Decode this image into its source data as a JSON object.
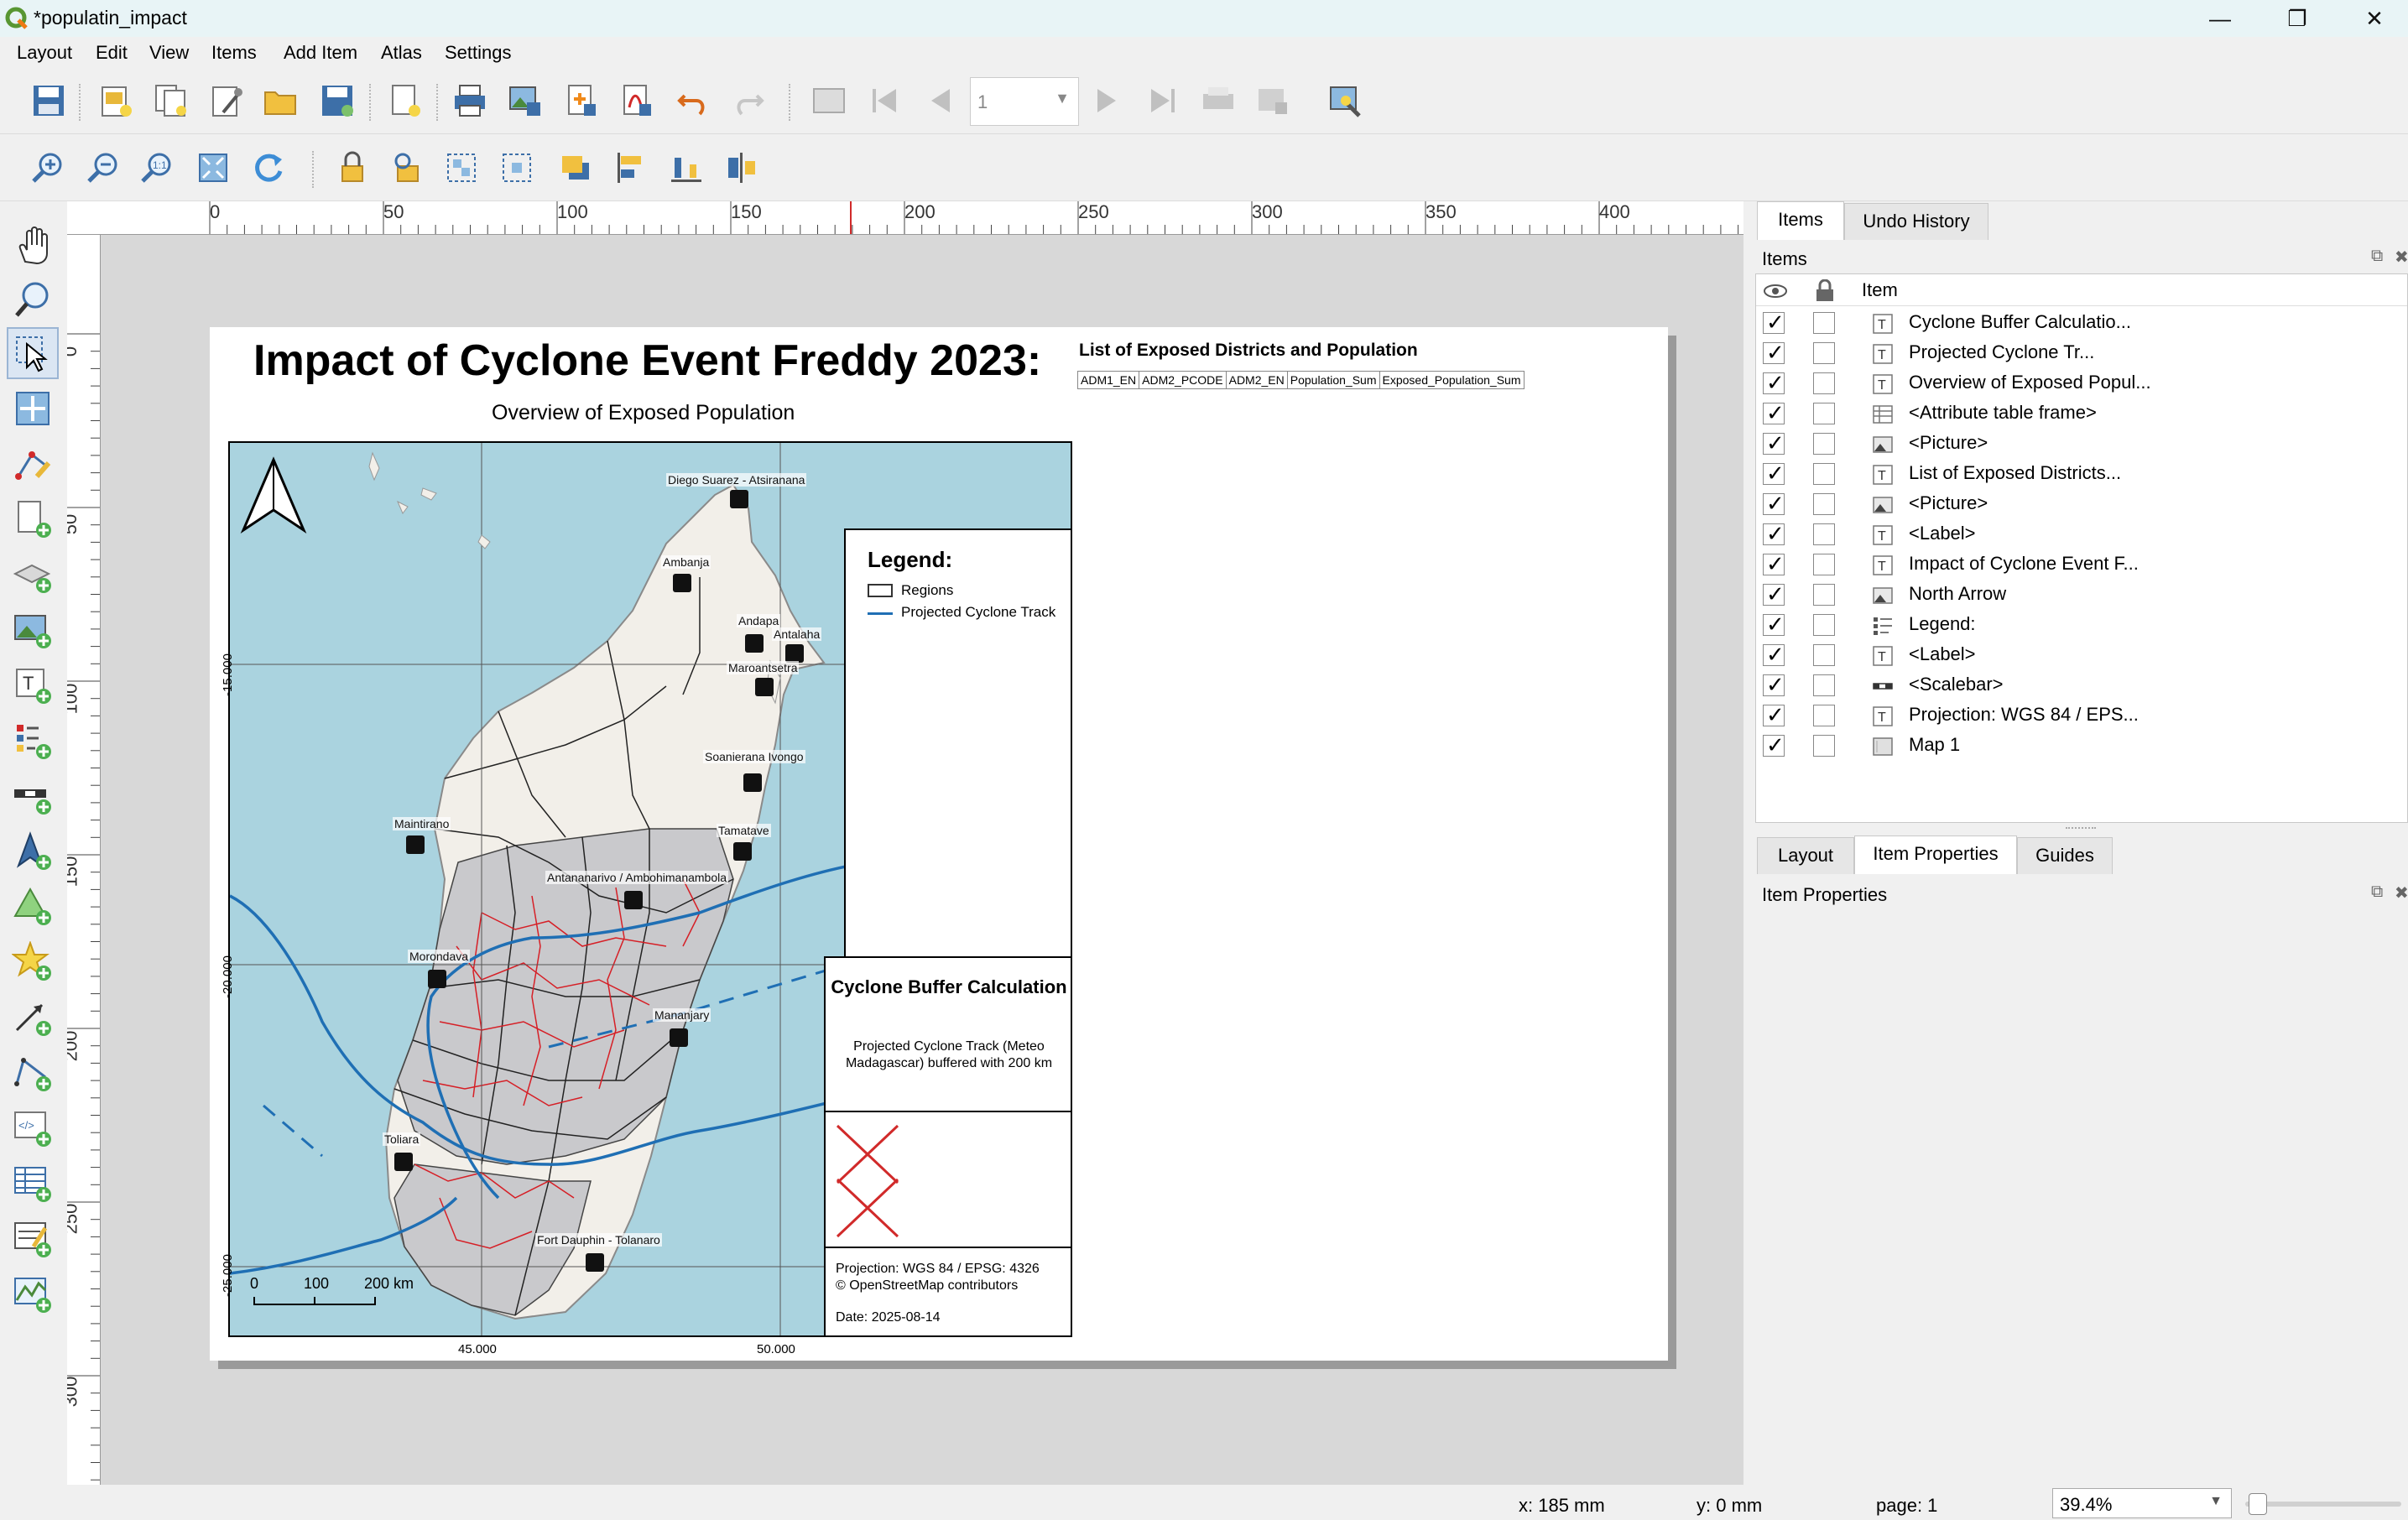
{
  "window": {
    "title": "*populatin_impact",
    "minimize_icon": "minimize-icon",
    "maximize_icon": "restore-icon",
    "close_icon": "close-icon"
  },
  "menubar": {
    "items": [
      "Layout",
      "Edit",
      "View",
      "Items",
      "Add Item",
      "Atlas",
      "Settings"
    ]
  },
  "toolbar": {
    "page_number_value": "1"
  },
  "ruler": {
    "horizontal_labels": [
      "0",
      "50",
      "100",
      "150",
      "200",
      "250",
      "300",
      "350",
      "400"
    ],
    "vertical_labels": [
      "0",
      "50",
      "100",
      "150",
      "200",
      "250",
      "300"
    ]
  },
  "layout": {
    "title": "Impact of Cyclone Event Freddy 2023:",
    "subtitle": "Overview of Exposed Population",
    "table_title": "List of Exposed Districts and Population",
    "table_columns": [
      "ADM1_EN",
      "ADM2_PCODE",
      "ADM2_EN",
      "Population_Sum",
      "Exposed_Population_Sum"
    ],
    "map": {
      "places": [
        "Diego Suarez - Atsiranana",
        "Ambanja",
        "Andapa",
        "Antalaha",
        "Maroantsetra",
        "Soanierana Ivongo",
        "Maintirano",
        "Tamatave",
        "Antananarivo / Ambohimanambola",
        "Morondava",
        "Mananjary",
        "Toliara",
        "Fort Dauphin - Tolanaro"
      ],
      "lat_labels": [
        "-15.000",
        "-20.000",
        "-25.000"
      ],
      "lon_labels": [
        "45.000",
        "50.000"
      ],
      "scalebar_labels": [
        "0",
        "100",
        "200 km"
      ],
      "colors": {
        "sea": "#aad3df",
        "land": "#f2efe9",
        "exposed": "#c9c9cc",
        "track": "#1f6fb4",
        "district": "#d61f26"
      }
    },
    "legend": {
      "title": "Legend:",
      "items": [
        "Regions",
        "Projected Cyclone Track"
      ]
    },
    "buffer": {
      "title": "Cyclone Buffer Calculation",
      "description": "Projected Cyclone Track (Meteo Madagascar) buffered with 200 km"
    },
    "projection": {
      "line1": "Projection: WGS 84 / EPSG: 4326",
      "line2": "© OpenStreetMap contributors",
      "date": "Date: 2025-08-14"
    }
  },
  "dock": {
    "top_tabs": [
      "Items",
      "Undo History"
    ],
    "items_title": "Items",
    "column_header": "Item",
    "items": [
      {
        "label": "Cyclone Buffer Calculatio...",
        "icon": "text-icon"
      },
      {
        "label": "Projected Cyclone Tr...",
        "icon": "text-icon"
      },
      {
        "label": "Overview of Exposed Popul...",
        "icon": "text-icon"
      },
      {
        "label": "<Attribute table frame>",
        "icon": "table-icon"
      },
      {
        "label": "<Picture>",
        "icon": "picture-icon"
      },
      {
        "label": "List of Exposed Districts...",
        "icon": "text-icon"
      },
      {
        "label": "<Picture>",
        "icon": "picture-icon"
      },
      {
        "label": "<Label>",
        "icon": "text-icon"
      },
      {
        "label": "Impact of Cyclone Event F...",
        "icon": "text-icon"
      },
      {
        "label": "North Arrow",
        "icon": "picture-icon"
      },
      {
        "label": "Legend:",
        "icon": "legend-icon"
      },
      {
        "label": "<Label>",
        "icon": "text-icon"
      },
      {
        "label": "<Scalebar>",
        "icon": "scalebar-icon"
      },
      {
        "label": "Projection: WGS 84 / EPS...",
        "icon": "text-icon"
      },
      {
        "label": "Map 1",
        "icon": "map-icon"
      }
    ],
    "bottom_tabs": [
      "Layout",
      "Item Properties",
      "Guides"
    ],
    "item_properties_title": "Item Properties"
  },
  "statusbar": {
    "x": "x: 185 mm",
    "y": "y: 0 mm",
    "page": "page: 1",
    "zoom": "39.4%"
  }
}
